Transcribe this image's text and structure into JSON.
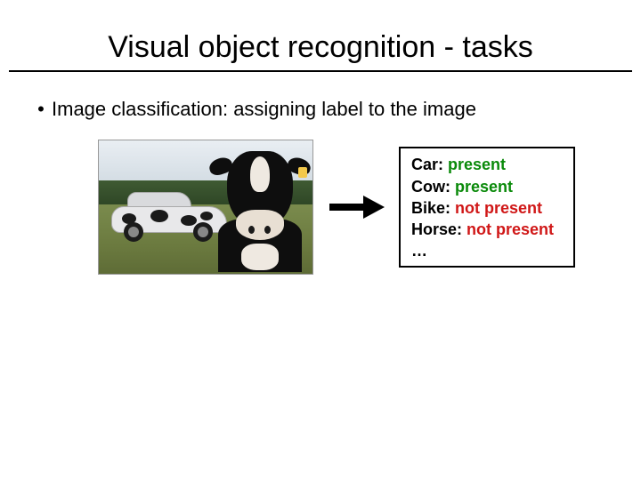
{
  "title": "Visual object recognition - tasks",
  "bullet1": "Image classification: assigning label to the image",
  "image_alt": "Photo of a cow-patterned car and a cow in a field",
  "labels": {
    "car": {
      "name": "Car",
      "status": "present",
      "present": true
    },
    "cow": {
      "name": "Cow",
      "status": "present",
      "present": true
    },
    "bike": {
      "name": "Bike",
      "status": "not present",
      "present": false
    },
    "horse": {
      "name": "Horse",
      "status": "not present",
      "present": false
    }
  },
  "ellipsis": "…"
}
